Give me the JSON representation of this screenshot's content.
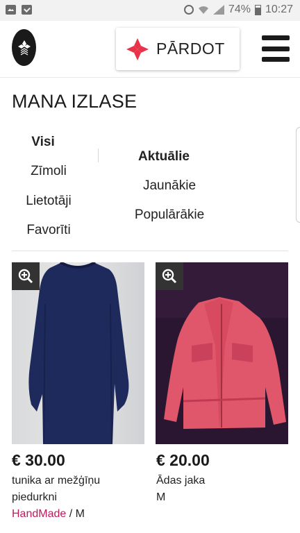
{
  "status_bar": {
    "battery": "74%",
    "time": "10:27"
  },
  "header": {
    "sell_label": "PĀRDOT"
  },
  "page": {
    "title": "MANA IZLASE"
  },
  "filters": {
    "left": [
      "Visi",
      "Zīmoli",
      "Lietotāji",
      "Favorīti"
    ],
    "right": [
      "Aktuālie",
      "Jaunākie",
      "Populārākie"
    ],
    "active_left": "Visi",
    "active_right": "Aktuālie"
  },
  "products": [
    {
      "price": "€ 30.00",
      "title": "tunika ar mežģīņu piedurkni",
      "brand": "HandMade",
      "size_sep": " / ",
      "size": "M"
    },
    {
      "price": "€ 20.00",
      "title": "Ādas jaka",
      "size": "M"
    }
  ],
  "colors": {
    "accent": "#e8334a",
    "brand_link": "#c2185b",
    "dark": "#1a1a1a"
  },
  "icons": {
    "status_left": [
      "image-icon",
      "checklist-icon"
    ],
    "status_right": [
      "alarm-icon",
      "wifi-icon",
      "signal-icon",
      "battery-icon"
    ],
    "zoom": "zoom-in-icon",
    "menu": "hamburger-icon",
    "sell": "diamond-star-icon"
  }
}
